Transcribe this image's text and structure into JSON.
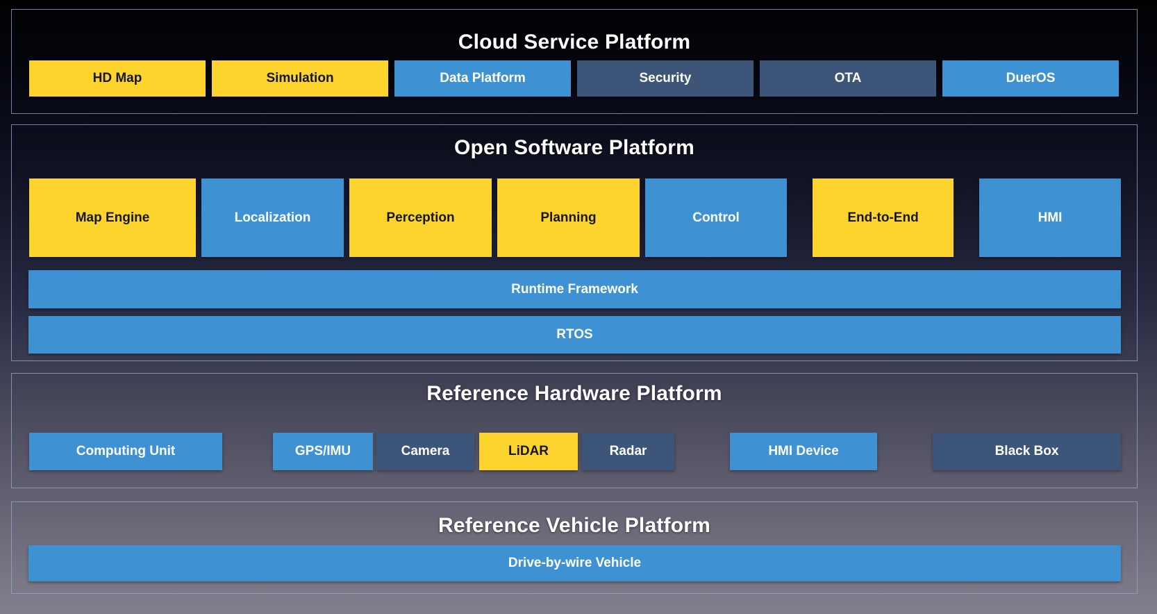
{
  "palette": {
    "yellow": "#FCD42D",
    "blue": "#3E92D4",
    "slate": "#3C5578",
    "panel_border": "#8BA6CF",
    "title_text": "#FFFFFF"
  },
  "sections": {
    "cloud": {
      "title": "Cloud Service Platform",
      "boxes": [
        {
          "label": "HD Map",
          "variant": "yellow"
        },
        {
          "label": "Simulation",
          "variant": "yellow"
        },
        {
          "label": "Data Platform",
          "variant": "blue"
        },
        {
          "label": "Security",
          "variant": "slate"
        },
        {
          "label": "OTA",
          "variant": "slate"
        },
        {
          "label": "DuerOS",
          "variant": "blue"
        }
      ]
    },
    "software": {
      "title": "Open Software Platform",
      "modules": [
        {
          "label": "Map Engine",
          "variant": "yellow"
        },
        {
          "label": "Localization",
          "variant": "blue"
        },
        {
          "label": "Perception",
          "variant": "yellow"
        },
        {
          "label": "Planning",
          "variant": "yellow"
        },
        {
          "label": "Control",
          "variant": "blue"
        },
        {
          "label": "End-to-End",
          "variant": "yellow"
        },
        {
          "label": "HMI",
          "variant": "blue"
        }
      ],
      "bars": [
        {
          "label": "Runtime Framework",
          "variant": "blue"
        },
        {
          "label": "RTOS",
          "variant": "blue"
        }
      ]
    },
    "hardware": {
      "title": "Reference Hardware Platform",
      "boxes": [
        {
          "label": "Computing Unit",
          "variant": "blue"
        },
        {
          "label": "GPS/IMU",
          "variant": "blue"
        },
        {
          "label": "Camera",
          "variant": "slate"
        },
        {
          "label": "LiDAR",
          "variant": "yellow"
        },
        {
          "label": "Radar",
          "variant": "slate"
        },
        {
          "label": "HMI Device",
          "variant": "blue"
        },
        {
          "label": "Black Box",
          "variant": "slate"
        }
      ]
    },
    "vehicle": {
      "title": "Reference Vehicle Platform",
      "bar": {
        "label": "Drive-by-wire Vehicle",
        "variant": "blue"
      }
    }
  }
}
